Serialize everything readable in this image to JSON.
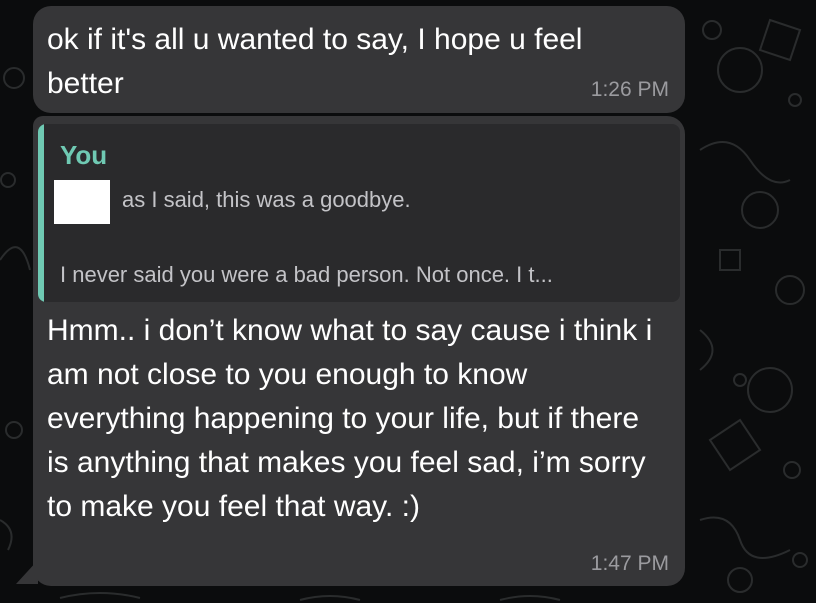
{
  "theme": {
    "background": "#0b0c0d",
    "bubble": "#363638",
    "quote_accent": "#6fc9b3",
    "timestamp_color": "#9b9b9f"
  },
  "messages": [
    {
      "text": "ok if it's all u wanted to say, I hope u feel better",
      "time": "1:26 PM"
    },
    {
      "quote": {
        "author": "You",
        "line1": "as I said, this was a goodbye.",
        "line2": "I never said you were a bad person. Not once. I t..."
      },
      "text": "Hmm.. i don’t know what to say cause i think i am not close to you enough to know everything happening to your life, but if there is anything that makes you feel sad, i’m sorry to make you feel that way. :)",
      "time": "1:47 PM"
    }
  ]
}
